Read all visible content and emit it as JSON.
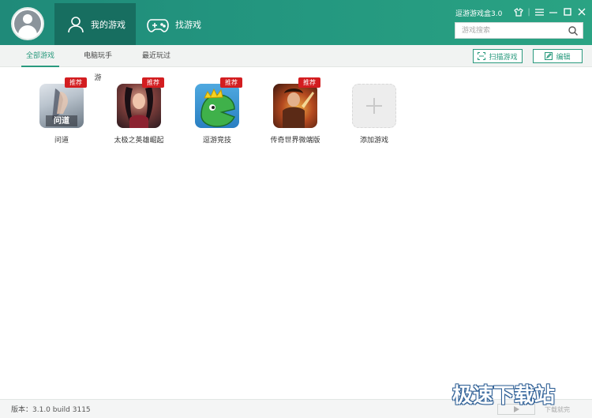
{
  "header": {
    "tabs": [
      {
        "label": "我的游戏",
        "icon": "user-icon",
        "active": true
      },
      {
        "label": "找游戏",
        "icon": "gamepad-icon",
        "active": false
      }
    ],
    "title": "逗游游戏盒3.0",
    "window_controls": [
      "skin-icon",
      "menu-icon",
      "minimize-icon",
      "maximize-icon",
      "close-icon"
    ],
    "search": {
      "placeholder": "游戏搜索",
      "icon": "search-icon"
    }
  },
  "subnav": {
    "tabs": [
      {
        "label": "全部游戏",
        "active": true
      },
      {
        "label": "电脑玩手游",
        "active": false
      },
      {
        "label": "最近玩过",
        "active": false
      }
    ],
    "buttons": [
      {
        "label": "扫描游戏",
        "icon": "scan-icon"
      },
      {
        "label": "编辑",
        "icon": "edit-icon"
      }
    ]
  },
  "games": [
    {
      "name": "问道",
      "badge": "推荐",
      "logo_text": "问道"
    },
    {
      "name": "太极之英雄崛起",
      "badge": "推荐"
    },
    {
      "name": "逗游竞技",
      "badge": "推荐"
    },
    {
      "name": "传奇世界微端版",
      "badge": "推荐"
    }
  ],
  "add_game": {
    "label": "添加游戏",
    "icon": "plus-icon"
  },
  "status": {
    "version": "版本：3.1.0 build 3115",
    "manage": "下载就完"
  },
  "watermark": "极速下载站",
  "colors": {
    "accent": "#2a9a7e",
    "header": "#23967f",
    "badge": "#d31d20"
  }
}
